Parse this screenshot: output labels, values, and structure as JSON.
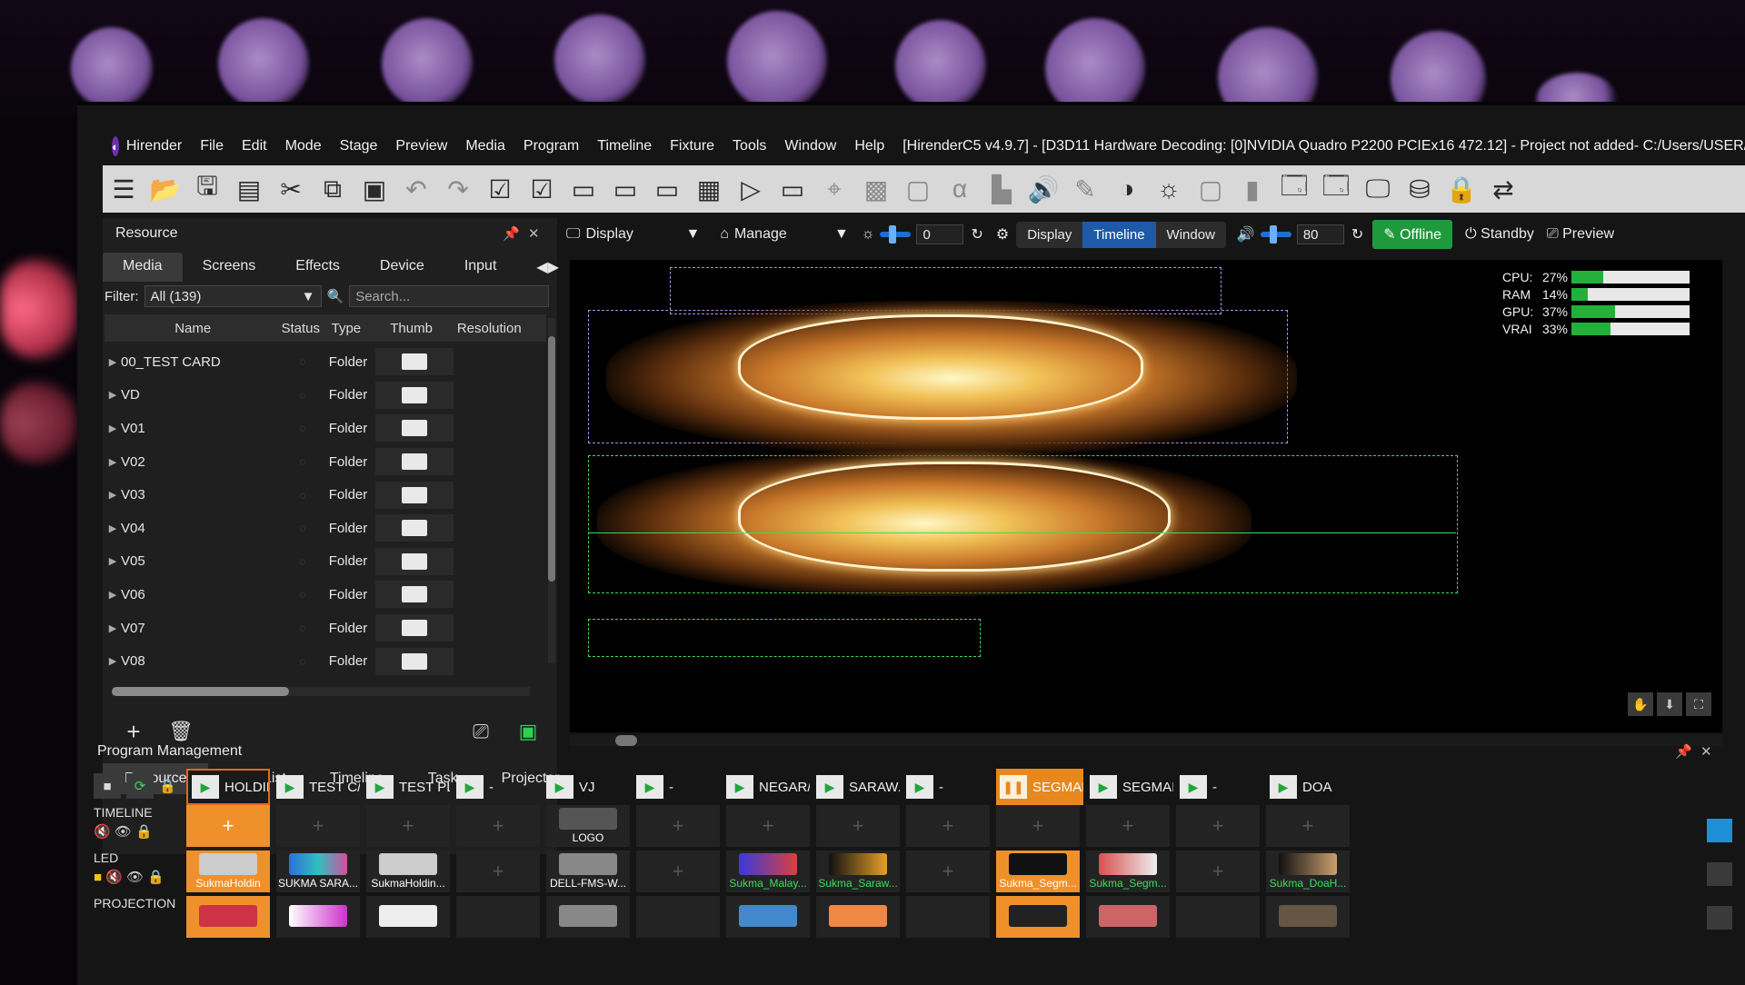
{
  "menubar": {
    "app": "Hirender",
    "items": [
      "File",
      "Edit",
      "Mode",
      "Stage",
      "Preview",
      "Media",
      "Program",
      "Timeline",
      "Fixture",
      "Tools",
      "Window",
      "Help"
    ],
    "title": "[HirenderC5 v4.9.7] - [D3D11 Hardware Decoding: [0]NVIDIA Quadro P2200 PCIEx16 472.12] - Project not added- C:/Users/USER/"
  },
  "toolbar": {
    "icons": [
      "list-icon",
      "open-folder-icon",
      "save-icon",
      "clipboard-icon",
      "cut-icon",
      "copy-icon",
      "paste-icon",
      "undo-icon",
      "redo-icon",
      "check-list-icon",
      "check-list-alt-icon",
      "media-frame-icon",
      "media-frame-alt-icon",
      "media-frame-2-icon",
      "grid-icon",
      "media-play-frame-icon",
      "media-stack-icon",
      "pin-icon",
      "mosaic-icon",
      "crop-icon",
      "alpha-icon",
      "chart-icon",
      "volume-icon",
      "feather-icon",
      "mask-icon",
      "brightness-icon",
      "frame-icon",
      "gradient-icon",
      "window-icon",
      "window-alt-icon",
      "monitor-icon",
      "network-icon",
      "lock-icon",
      "transform-icon"
    ]
  },
  "resource": {
    "title": "Resource",
    "tabs": [
      "Media",
      "Screens",
      "Effects",
      "Device",
      "Input"
    ],
    "filter_label": "Filter:",
    "filter_value": "All  (139)",
    "search_placeholder": "Search...",
    "columns": [
      "Name",
      "Status",
      "Type",
      "Thumb",
      "Resolution"
    ],
    "rows": [
      {
        "name": "00_TEST CARD",
        "type": "Folder"
      },
      {
        "name": "VD",
        "type": "Folder"
      },
      {
        "name": "V01",
        "type": "Folder"
      },
      {
        "name": "V02",
        "type": "Folder"
      },
      {
        "name": "V03",
        "type": "Folder"
      },
      {
        "name": "V04",
        "type": "Folder"
      },
      {
        "name": "V05",
        "type": "Folder"
      },
      {
        "name": "V06",
        "type": "Folder"
      },
      {
        "name": "V07",
        "type": "Folder"
      },
      {
        "name": "V08",
        "type": "Folder"
      }
    ],
    "bottom_tabs": [
      "Resource",
      "PGMList",
      "Timeline",
      "Task",
      "Projector"
    ]
  },
  "preview": {
    "display_label": "Display",
    "manage_label": "Manage",
    "brightness_value": "0",
    "mode_tabs": [
      "Display",
      "Timeline",
      "Window"
    ],
    "active_mode": "Timeline",
    "volume_value": "80",
    "offline_label": "Offline",
    "standby_label": "Standby",
    "preview_label": "Preview",
    "stats": [
      {
        "label": "CPU:",
        "value": "27%",
        "fraction": 0.27
      },
      {
        "label": "RAM",
        "value": "14%",
        "fraction": 0.14
      },
      {
        "label": "GPU:",
        "value": "37%",
        "fraction": 0.37
      },
      {
        "label": "VRAI",
        "value": "33%",
        "fraction": 0.33
      }
    ]
  },
  "program": {
    "title": "Program Management",
    "programs": [
      {
        "label": "HOLDIN",
        "state": "hold"
      },
      {
        "label": "TEST C/",
        "state": "normal"
      },
      {
        "label": "TEST PL",
        "state": "normal"
      },
      {
        "label": "-",
        "state": "normal"
      },
      {
        "label": "VJ",
        "state": "normal"
      },
      {
        "label": "-",
        "state": "normal"
      },
      {
        "label": "NEGAR/",
        "state": "normal"
      },
      {
        "label": "SARAW.",
        "state": "normal"
      },
      {
        "label": "-",
        "state": "normal"
      },
      {
        "label": "SEGMAI",
        "state": "segment"
      },
      {
        "label": "SEGMAI",
        "state": "normal"
      },
      {
        "label": "-",
        "state": "normal"
      },
      {
        "label": "DOA",
        "state": "normal"
      }
    ],
    "layers": [
      "TIMELINE",
      "LED",
      "PROJECTION"
    ],
    "timeline_row": [
      "",
      "",
      "",
      "",
      "LOGO",
      "",
      "",
      "",
      "",
      "",
      "",
      "",
      ""
    ],
    "led_row": [
      "SukmaHoldin",
      "SUKMA SARA...",
      "SukmaHoldin...",
      "",
      "DELL-FMS-W...",
      "",
      "Sukma_Malay...",
      "Sukma_Saraw...",
      "",
      "Sukma_Segm...",
      "Sukma_Segm...",
      "",
      "Sukma_DoaH..."
    ]
  }
}
